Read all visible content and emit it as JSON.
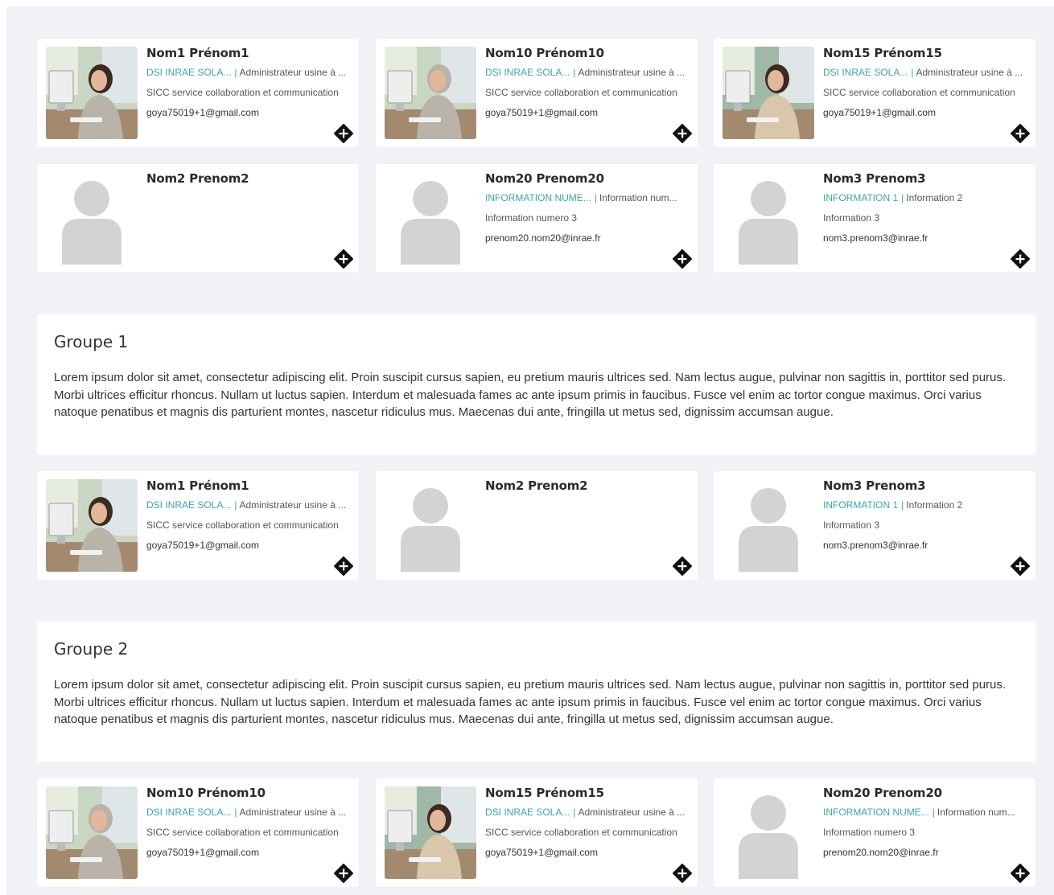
{
  "colors": {
    "background": "#f2f2f6",
    "accent": "#3aa6a8",
    "card": "#ffffff",
    "placeholder": "#d3d3d3"
  },
  "top_cards": [
    {
      "name": "Nom1 Prénom1",
      "org": "DSI INRAE SOLA...",
      "role": "Administrateur usine à ...",
      "info": "SICC service collaboration et communication",
      "email": "goya75019+1@gmail.com",
      "photo": "photo-woman-dark-hair-at-computer"
    },
    {
      "name": "Nom10 Prénom10",
      "org": "DSI INRAE SOLA...",
      "role": "Administrateur usine à ...",
      "info": "SICC service collaboration et communication",
      "email": "goya75019+1@gmail.com",
      "photo": "photo-woman-grey-hair-at-computer"
    },
    {
      "name": "Nom15 Prénom15",
      "org": "DSI INRAE SOLA...",
      "role": "Administrateur usine à ...",
      "info": "SICC service collaboration et communication",
      "email": "goya75019+1@gmail.com",
      "photo": "photo-woman-office-window"
    },
    {
      "name": "Nom2 Prenom2",
      "org": "",
      "role": "",
      "info": "",
      "email": "",
      "photo": ""
    },
    {
      "name": "Nom20 Prenom20",
      "org": "INFORMATION NUME...",
      "role": "Information num...",
      "info": "Information numero 3",
      "email": "prenom20.nom20@inrae.fr",
      "photo": ""
    },
    {
      "name": "Nom3 Prenom3",
      "org": "INFORMATION 1",
      "role": "Information 2",
      "info": "Information 3",
      "email": "nom3.prenom3@inrae.fr",
      "photo": ""
    }
  ],
  "groups": [
    {
      "title": "Groupe 1",
      "description": "Lorem ipsum dolor sit amet, consectetur adipiscing elit. Proin suscipit cursus sapien, eu pretium mauris ultrices sed. Nam lectus augue, pulvinar non sagittis in, porttitor sed purus. Morbi ultrices efficitur rhoncus. Nullam ut luctus sapien. Interdum et malesuada fames ac ante ipsum primis in faucibus. Fusce vel enim ac tortor congue maximus. Orci varius natoque penatibus et magnis dis parturient montes, nascetur ridiculus mus. Maecenas dui ante, fringilla ut metus sed, dignissim accumsan augue.",
      "members": [
        {
          "name": "Nom1 Prénom1",
          "org": "DSI INRAE SOLA...",
          "role": "Administrateur usine à ...",
          "info": "SICC service collaboration et communication",
          "email": "goya75019+1@gmail.com",
          "photo": "photo-woman-dark-hair-at-computer"
        },
        {
          "name": "Nom2 Prenom2",
          "org": "",
          "role": "",
          "info": "",
          "email": "",
          "photo": ""
        },
        {
          "name": "Nom3 Prenom3",
          "org": "INFORMATION 1",
          "role": "Information 2",
          "info": "Information 3",
          "email": "nom3.prenom3@inrae.fr",
          "photo": ""
        }
      ]
    },
    {
      "title": "Groupe 2",
      "description": "Lorem ipsum dolor sit amet, consectetur adipiscing elit. Proin suscipit cursus sapien, eu pretium mauris ultrices sed. Nam lectus augue, pulvinar non sagittis in, porttitor sed purus. Morbi ultrices efficitur rhoncus. Nullam ut luctus sapien. Interdum et malesuada fames ac ante ipsum primis in faucibus. Fusce vel enim ac tortor congue maximus. Orci varius natoque penatibus et magnis dis parturient montes, nascetur ridiculus mus. Maecenas dui ante, fringilla ut metus sed, dignissim accumsan augue.",
      "members": [
        {
          "name": "Nom10 Prénom10",
          "org": "DSI INRAE SOLA...",
          "role": "Administrateur usine à ...",
          "info": "SICC service collaboration et communication",
          "email": "goya75019+1@gmail.com",
          "photo": "photo-woman-grey-hair-at-computer"
        },
        {
          "name": "Nom15 Prénom15",
          "org": "DSI INRAE SOLA...",
          "role": "Administrateur usine à ...",
          "info": "SICC service collaboration et communication",
          "email": "goya75019+1@gmail.com",
          "photo": "photo-woman-office-window"
        },
        {
          "name": "Nom20 Prenom20",
          "org": "INFORMATION NUME...",
          "role": "Information num...",
          "info": "Information numero 3",
          "email": "prenom20.nom20@inrae.fr",
          "photo": ""
        }
      ]
    }
  ],
  "icons": {
    "add": "plus-diamond-icon",
    "placeholder": "person-placeholder-icon"
  }
}
